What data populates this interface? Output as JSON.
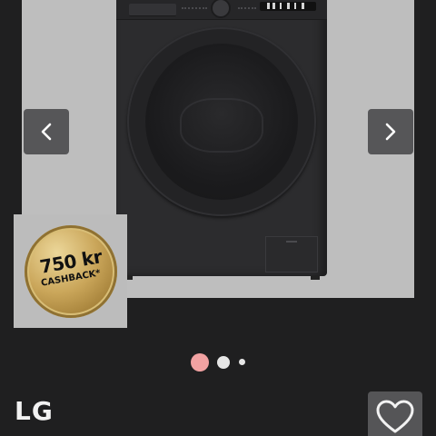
{
  "gallery": {
    "prev_icon": "chevron-left-icon",
    "next_icon": "chevron-right-icon",
    "slide_count": 3,
    "active_slide": 1
  },
  "promo": {
    "amount": "750 kr",
    "label": "CASHBACK*",
    "icon": "cashback-coin-icon"
  },
  "product": {
    "brand": "LG",
    "favorite_icon": "heart-icon"
  },
  "colors": {
    "background": "#1f1f20",
    "photo_bg": "#bebebe",
    "nav_button": "#565658",
    "dot_active": "#f2a2a2",
    "dot_inactive": "#e6e6e6",
    "coin_gold": "#caa65a"
  }
}
